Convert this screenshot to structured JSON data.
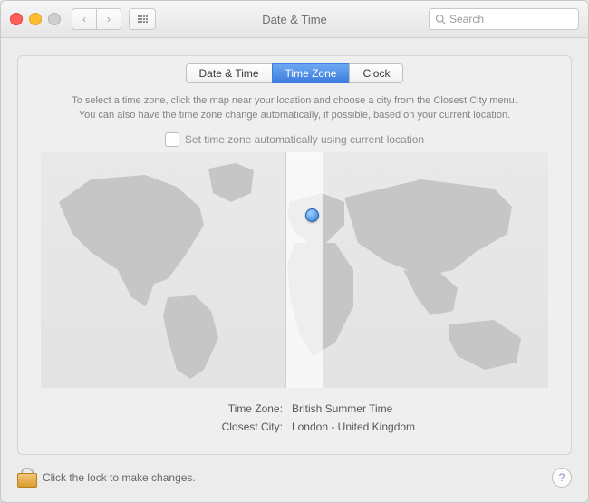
{
  "window": {
    "title": "Date & Time"
  },
  "toolbar": {
    "search_placeholder": "Search"
  },
  "tabs": {
    "date_time": "Date & Time",
    "time_zone": "Time Zone",
    "clock": "Clock",
    "selected": "time_zone"
  },
  "instructions": {
    "line1": "To select a time zone, click the map near your location and choose a city from the Closest City menu.",
    "line2": "You can also have the time zone change automatically, if possible, based on your current location."
  },
  "auto_checkbox": {
    "label": "Set time zone automatically using current location",
    "checked": false
  },
  "details": {
    "timezone_label": "Time Zone:",
    "timezone_value": "British Summer Time",
    "city_label": "Closest City:",
    "city_value": "London - United Kingdom"
  },
  "footer": {
    "lock_text": "Click the lock to make changes."
  },
  "icons": {
    "help": "?",
    "back": "‹",
    "fwd": "›"
  }
}
